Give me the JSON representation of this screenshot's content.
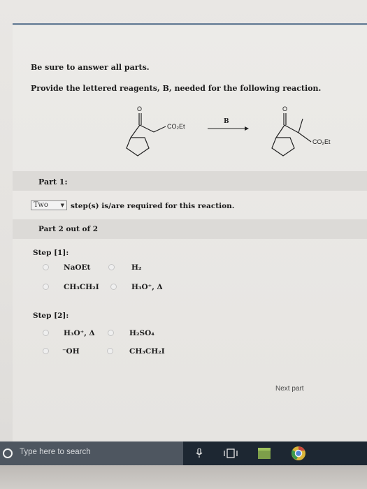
{
  "instructions": {
    "intro": "Be sure to answer all parts.",
    "question": "Provide the lettered reagents, B, needed for the following reaction."
  },
  "reaction": {
    "reagent_label": "B",
    "reactant_group": "CO₂Et",
    "product_group": "CO₂Et",
    "carbonyl_atom": "O"
  },
  "part1": {
    "label": "Part 1:",
    "selected_value": "Two",
    "suffix": "step(s) is/are required for this reaction."
  },
  "part2": {
    "label": "Part 2 out of 2"
  },
  "step1": {
    "label": "Step [1]:",
    "options": [
      "NaOEt",
      "H₂",
      "CH₃CH₂I",
      "H₃O⁺, Δ"
    ]
  },
  "step2": {
    "label": "Step [2]:",
    "options": [
      "H₃O⁺, Δ",
      "H₂SO₄",
      "⁻OH",
      "CH₃CH₂I"
    ]
  },
  "next_button": "Next part",
  "taskbar": {
    "search_placeholder": "Type here to search"
  }
}
